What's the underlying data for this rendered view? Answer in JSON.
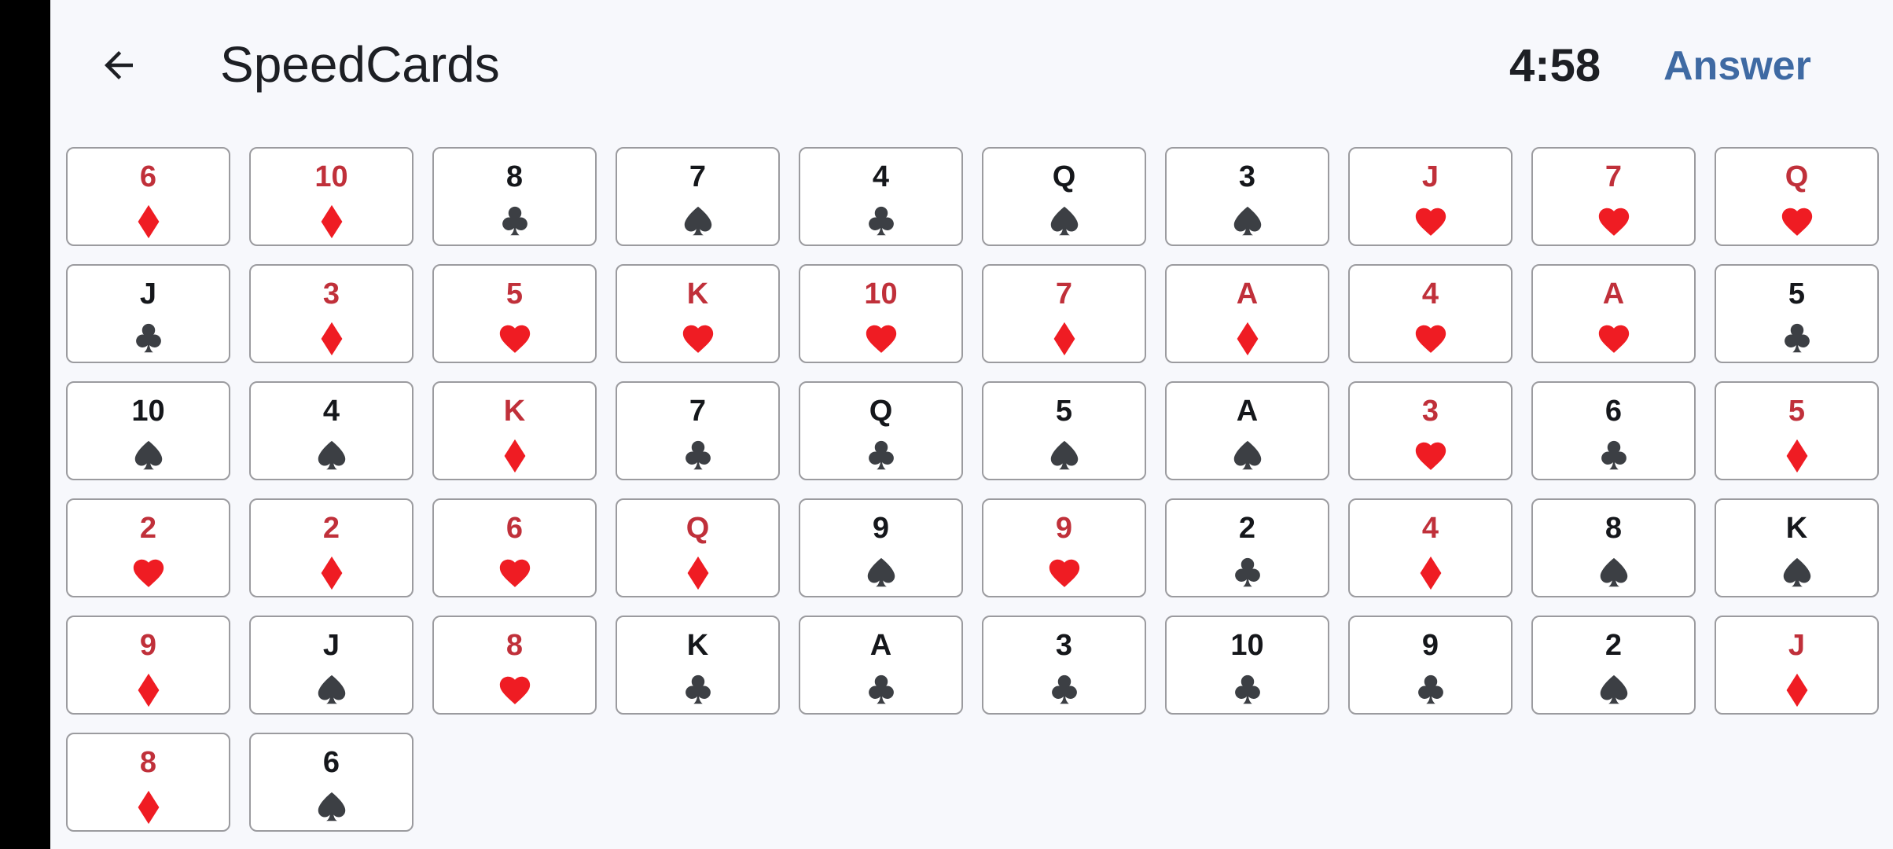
{
  "app": {
    "title": "SpeedCards",
    "timer": "4:58",
    "answer_label": "Answer"
  },
  "icons": {
    "back": "arrow-left-icon"
  },
  "colors": {
    "red_suit": "#ef1c23",
    "black_suit": "#3c3f44",
    "red_rank": "#c0303a",
    "black_rank": "#15171b",
    "accent": "#3f6aa3"
  },
  "cards": [
    {
      "rank": "6",
      "suit": "diamond"
    },
    {
      "rank": "10",
      "suit": "diamond"
    },
    {
      "rank": "8",
      "suit": "club"
    },
    {
      "rank": "7",
      "suit": "spade"
    },
    {
      "rank": "4",
      "suit": "club"
    },
    {
      "rank": "Q",
      "suit": "spade"
    },
    {
      "rank": "3",
      "suit": "spade"
    },
    {
      "rank": "J",
      "suit": "heart"
    },
    {
      "rank": "7",
      "suit": "heart"
    },
    {
      "rank": "Q",
      "suit": "heart"
    },
    {
      "rank": "J",
      "suit": "club"
    },
    {
      "rank": "3",
      "suit": "diamond"
    },
    {
      "rank": "5",
      "suit": "heart"
    },
    {
      "rank": "K",
      "suit": "heart"
    },
    {
      "rank": "10",
      "suit": "heart"
    },
    {
      "rank": "7",
      "suit": "diamond"
    },
    {
      "rank": "A",
      "suit": "diamond"
    },
    {
      "rank": "4",
      "suit": "heart"
    },
    {
      "rank": "A",
      "suit": "heart"
    },
    {
      "rank": "5",
      "suit": "club"
    },
    {
      "rank": "10",
      "suit": "spade"
    },
    {
      "rank": "4",
      "suit": "spade"
    },
    {
      "rank": "K",
      "suit": "diamond"
    },
    {
      "rank": "7",
      "suit": "club"
    },
    {
      "rank": "Q",
      "suit": "club"
    },
    {
      "rank": "5",
      "suit": "spade"
    },
    {
      "rank": "A",
      "suit": "spade"
    },
    {
      "rank": "3",
      "suit": "heart"
    },
    {
      "rank": "6",
      "suit": "club"
    },
    {
      "rank": "5",
      "suit": "diamond"
    },
    {
      "rank": "2",
      "suit": "heart"
    },
    {
      "rank": "2",
      "suit": "diamond"
    },
    {
      "rank": "6",
      "suit": "heart"
    },
    {
      "rank": "Q",
      "suit": "diamond"
    },
    {
      "rank": "9",
      "suit": "spade"
    },
    {
      "rank": "9",
      "suit": "heart"
    },
    {
      "rank": "2",
      "suit": "club"
    },
    {
      "rank": "4",
      "suit": "diamond"
    },
    {
      "rank": "8",
      "suit": "spade"
    },
    {
      "rank": "K",
      "suit": "spade"
    },
    {
      "rank": "9",
      "suit": "diamond"
    },
    {
      "rank": "J",
      "suit": "spade"
    },
    {
      "rank": "8",
      "suit": "heart"
    },
    {
      "rank": "K",
      "suit": "club"
    },
    {
      "rank": "A",
      "suit": "club"
    },
    {
      "rank": "3",
      "suit": "club"
    },
    {
      "rank": "10",
      "suit": "club"
    },
    {
      "rank": "9",
      "suit": "club"
    },
    {
      "rank": "2",
      "suit": "spade"
    },
    {
      "rank": "J",
      "suit": "diamond"
    },
    {
      "rank": "8",
      "suit": "diamond"
    },
    {
      "rank": "6",
      "suit": "spade"
    }
  ]
}
